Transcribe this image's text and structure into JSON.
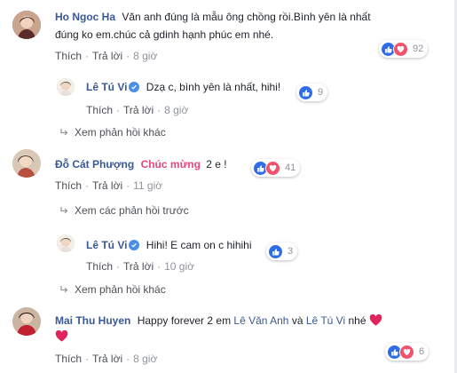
{
  "comments": [
    {
      "author": "Ho Ngoc Ha",
      "text_line1": "Văn anh đúng là mẫu ông chồng rồi.Bình yên là nhất",
      "text_line2": "đúng ko em.chúc cả gdinh hạnh phúc em nhé.",
      "like": "Thích",
      "reply": "Trả lời",
      "time": "8 giờ",
      "reaction_count": "92",
      "reply_item": {
        "author": "Lê Tú Vi",
        "text": "Dzạ c, bình yên là nhất, hihi!",
        "like": "Thích",
        "reply": "Trả lời",
        "time": "8 giờ",
        "reaction_count": "9"
      },
      "more_replies": "Xem phản hồi khác"
    },
    {
      "author": "Đỗ Cát Phượng",
      "tag": "Chúc mừng",
      "text": "2 e !",
      "like": "Thích",
      "reply": "Trả lời",
      "time": "11 giờ",
      "reaction_count": "41",
      "previous_replies": "Xem các phản hồi trước",
      "reply_item": {
        "author": "Lê Tú Vi",
        "text": "Hihi! E cam on c hihihi",
        "like": "Thích",
        "reply": "Trả lời",
        "time": "10 giờ",
        "reaction_count": "3"
      },
      "more_replies": "Xem phản hồi khác"
    },
    {
      "author": "Mai Thu Huyen",
      "text_pre": "Happy forever 2 em",
      "mention1": "Lê Văn Anh",
      "text_and": "và",
      "mention2": "Lê Tú Vi",
      "text_post": "nhé",
      "like": "Thích",
      "reply": "Trả lời",
      "time": "8 giờ",
      "reaction_count": "6"
    }
  ],
  "colors": {
    "name_link": "#385898",
    "meta_gray": "#90949c",
    "like_blue": "#2f6ce5",
    "love_red": "#f2526b",
    "tag_pink": "#e4477e"
  },
  "icons": [
    "like-reaction-icon",
    "love-reaction-icon",
    "verified-badge-icon",
    "reply-arrow-icon",
    "heart-emoji-icon"
  ]
}
